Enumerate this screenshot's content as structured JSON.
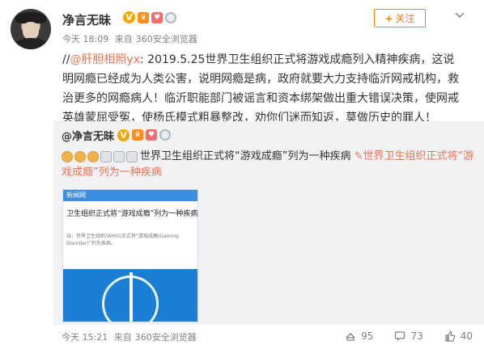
{
  "author": {
    "name": "净言无昧",
    "time": "今天 18:09",
    "source_prefix": "来自",
    "source": "360安全浏览器"
  },
  "follow": {
    "plus": "+",
    "label": "关注"
  },
  "post": {
    "prefix": "//",
    "mention": "@肝胆相照yx",
    "colon": ":",
    "text": " 2019.5.25世界卫生组织正式将游戏成瘾列入精神疾病，这说明网瘾已经成为人类公害，说明网瘾是病，政府就要大力支持临沂网戒机构，救治更多的网瘾病人！临沂职能部门被谣言和资本绑架做出重大错误决策，使网戒英雄蒙屈受冤，使杨氏模式粗暴整改，劝你们迷而知返，莫做历史的罪人！"
  },
  "repost": {
    "author": "@净言无昧",
    "text": "世界卫生组织正式将“游戏成瘾”列为一种疾病",
    "link_text": "世界卫生组织正式将“游戏成瘾”列为一种疾病",
    "thumb_header": "新闻网",
    "thumb_title": "卫生组织正式将“游戏成瘾”列为一种疾病",
    "thumb_body": "日，世界卫生组织(WHO)正式将“游戏成瘾(Gaming Disorder)”列为疾病。",
    "time": "今天 15:21",
    "source_prefix": "来自",
    "source": "360安全浏览器"
  },
  "actions": {
    "repost_count": "95",
    "comment_count": "73",
    "like_count": "40"
  },
  "colors": {
    "accent": "#ff8200",
    "link": "#eb7350",
    "repost_bg": "#f2f2f5"
  }
}
